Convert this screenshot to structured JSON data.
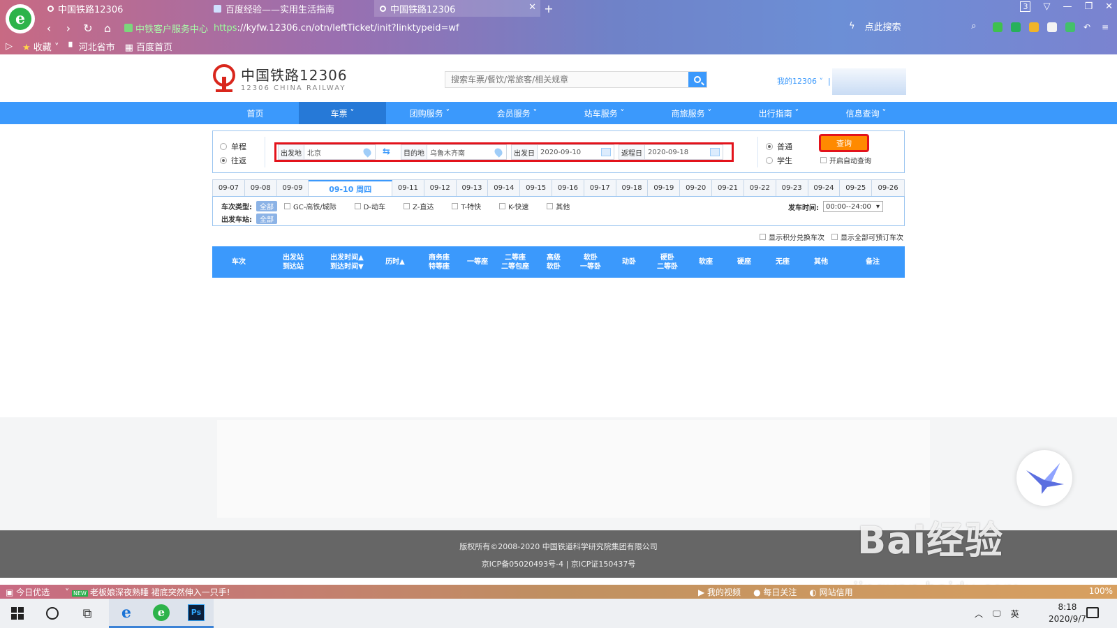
{
  "browser": {
    "tabs": [
      {
        "title": "中国铁路12306",
        "active": false
      },
      {
        "title": "百度经验——实用生活指南",
        "active": false
      },
      {
        "title": "中国铁路12306",
        "active": true
      }
    ],
    "window_badge": "3",
    "cert_label": "中铁客户服务中心",
    "url_scheme": "https",
    "url_rest": "://kyfw.12306.cn/otn/leftTicket/init?linktypeid=wf",
    "search_label": "点此搜索",
    "bookmarks": {
      "fav": "收藏",
      "item1": "河北省市",
      "item2": "百度首页"
    }
  },
  "site": {
    "logo_cn": "中国铁路12306",
    "logo_en": "12306 CHINA RAILWAY",
    "search_placeholder": "搜索车票/餐饮/常旅客/相关规章",
    "my12306": "我的12306"
  },
  "nav": [
    "首页",
    "车票",
    "团购服务",
    "会员服务",
    "站车服务",
    "商旅服务",
    "出行指南",
    "信息查询"
  ],
  "query": {
    "trip_single": "单程",
    "trip_round": "往返",
    "from_label": "出发地",
    "from_value": "北京",
    "to_label": "目的地",
    "to_value": "乌鲁木齐南",
    "depart_label": "出发日",
    "depart_value": "2020-09-10",
    "return_label": "返程日",
    "return_value": "2020-09-18",
    "normal": "普通",
    "student": "学生",
    "query_btn": "查询",
    "auto_query": "开启自动查询"
  },
  "dates": [
    "09-07",
    "09-08",
    "09-09",
    "09-10 周四",
    "09-11",
    "09-12",
    "09-13",
    "09-14",
    "09-15",
    "09-16",
    "09-17",
    "09-18",
    "09-19",
    "09-20",
    "09-21",
    "09-22",
    "09-23",
    "09-24",
    "09-25",
    "09-26"
  ],
  "filters": {
    "train_type_label": "车次类型:",
    "all": "全部",
    "types": [
      "GC-高铁/城际",
      "D-动车",
      "Z-直达",
      "T-特快",
      "K-快速",
      "其他"
    ],
    "station_label": "出发车站:",
    "time_label": "发车时间:",
    "time_value": "00:00--24:00"
  },
  "extra": {
    "points": "显示积分兑换车次",
    "all_bookable": "显示全部可预订车次"
  },
  "table_headers": [
    [
      "车次"
    ],
    [
      "出发站",
      "到达站"
    ],
    [
      "出发时间▲",
      "到达时间▼"
    ],
    [
      "历时▲"
    ],
    [
      "商务座",
      "特等座"
    ],
    [
      "一等座"
    ],
    [
      "二等座",
      "二等包座"
    ],
    [
      "高级",
      "软卧"
    ],
    [
      "软卧",
      "一等卧"
    ],
    [
      "动卧"
    ],
    [
      "硬卧",
      "二等卧"
    ],
    [
      "软座"
    ],
    [
      "硬座"
    ],
    [
      "无座"
    ],
    [
      "其他"
    ],
    [
      "备注"
    ]
  ],
  "footer": {
    "copyright": "版权所有©2008-2020   中国铁道科学研究院集团有限公司",
    "icp": "京ICP备05020493号-4    |    京ICP证150437号"
  },
  "watermark": {
    "brand": "Bai经验",
    "url": "jingyan.baidu.com"
  },
  "statusbar": {
    "today": "今日优选",
    "news": "老板娘深夜熟睡 裙底突然伸入一只手!",
    "my_video": "我的视频",
    "daily": "每日关注",
    "credit": "网站信用",
    "zoom": "100%"
  },
  "taskbar": {
    "time": "8:18",
    "date": "2020/9/7",
    "ime": "英"
  },
  "colors": {
    "brand_blue": "#3b99fc",
    "rail_red": "#d9261c",
    "highlight_red": "#e3131b",
    "query_orange": "#ff8a00"
  }
}
